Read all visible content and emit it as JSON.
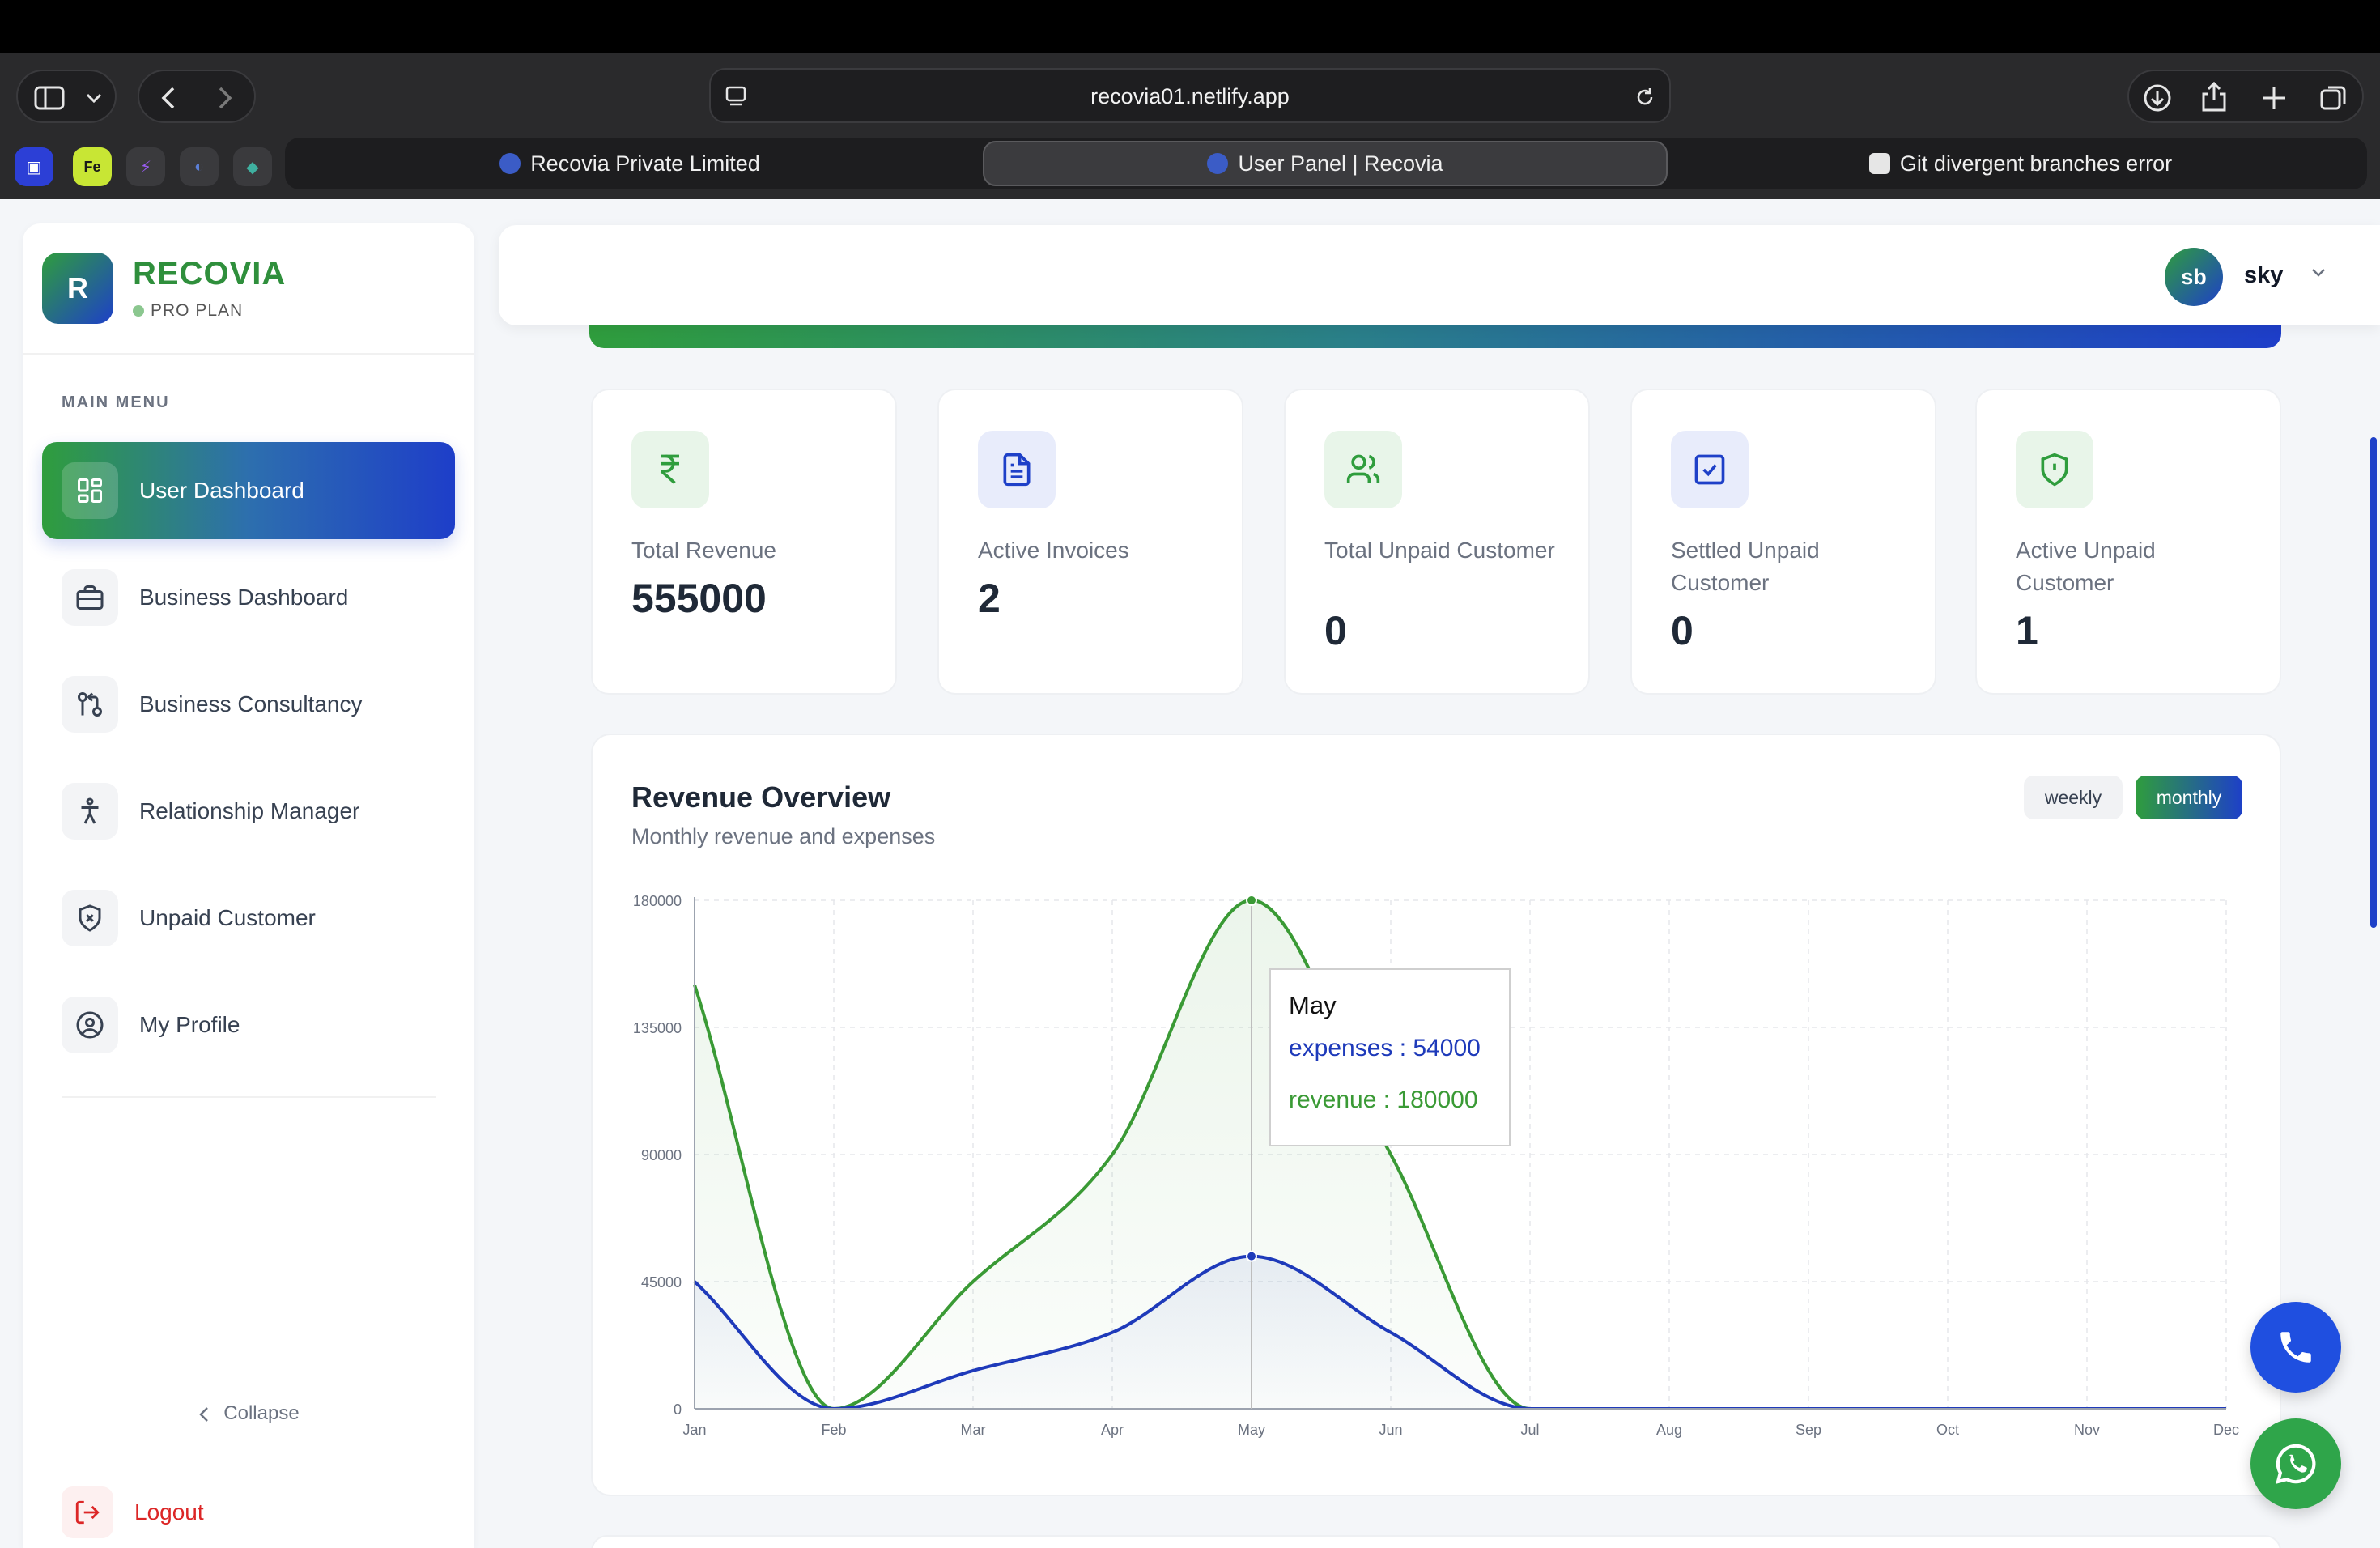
{
  "browser": {
    "url": "recovia01.netlify.app",
    "tabs": [
      {
        "label": "Recovia Private Limited",
        "active": false
      },
      {
        "label": "User Panel | Recovia",
        "active": true
      },
      {
        "label": "Git divergent branches error",
        "active": false
      }
    ],
    "extensions": [
      "app-icon",
      "Fe",
      "bolt-icon",
      "globe-icon",
      "diamond-icon"
    ]
  },
  "sidebar": {
    "brand": "RECOVIA",
    "logo_letter": "R",
    "plan": "PRO PLAN",
    "menu_heading": "MAIN MENU",
    "items": [
      {
        "label": "User Dashboard",
        "icon": "dashboard-grid-icon",
        "active": true
      },
      {
        "label": "Business Dashboard",
        "icon": "briefcase-icon",
        "active": false
      },
      {
        "label": "Business Consultancy",
        "icon": "git-compare-icon",
        "active": false
      },
      {
        "label": "Relationship Manager",
        "icon": "accessibility-person-icon",
        "active": false
      },
      {
        "label": "Unpaid Customer",
        "icon": "shield-x-icon",
        "active": false
      },
      {
        "label": "My Profile",
        "icon": "user-circle-icon",
        "active": false
      }
    ],
    "collapse_label": "Collapse",
    "logout_label": "Logout"
  },
  "header": {
    "avatar_initials": "sb",
    "username": "sky"
  },
  "stats": [
    {
      "label": "Total Revenue",
      "value": "555000",
      "icon": "rupee-icon",
      "color": "#2f9d3d"
    },
    {
      "label": "Active Invoices",
      "value": "2",
      "icon": "document-icon",
      "color": "#1e40c8"
    },
    {
      "label": "Total Unpaid Customer",
      "value": "0",
      "icon": "users-icon",
      "color": "#2f9d3d"
    },
    {
      "label": "Settled Unpaid Customer",
      "value": "0",
      "icon": "check-square-icon",
      "color": "#1e40c8"
    },
    {
      "label": "Active Unpaid Customer",
      "value": "1",
      "icon": "shield-alert-icon",
      "color": "#2f9d3d"
    }
  ],
  "revenue_panel": {
    "title": "Revenue Overview",
    "subtitle": "Monthly revenue and expenses",
    "toggle": {
      "weekly": "weekly",
      "monthly": "monthly",
      "selected": "monthly"
    },
    "tooltip": {
      "title": "May",
      "expenses_label": "expenses : 54000",
      "revenue_label": "revenue : 180000"
    }
  },
  "chart_data": {
    "type": "area",
    "title": "Revenue Overview",
    "x": [
      "Jan",
      "Feb",
      "Mar",
      "Apr",
      "May",
      "Jun",
      "Jul",
      "Aug",
      "Sep",
      "Oct",
      "Nov",
      "Dec"
    ],
    "yticks": [
      0,
      45000,
      90000,
      135000,
      180000
    ],
    "ylim": [
      0,
      180000
    ],
    "grid": true,
    "series": [
      {
        "name": "revenue",
        "color": "#3a9a35",
        "values": [
          150000,
          0,
          45000,
          90000,
          180000,
          90000,
          0,
          0,
          0,
          0,
          0,
          0
        ]
      },
      {
        "name": "expenses",
        "color": "#1e3aba",
        "values": [
          45000,
          0,
          13500,
          27000,
          54000,
          27000,
          0,
          0,
          0,
          0,
          0,
          0
        ]
      }
    ],
    "highlight": "May"
  }
}
